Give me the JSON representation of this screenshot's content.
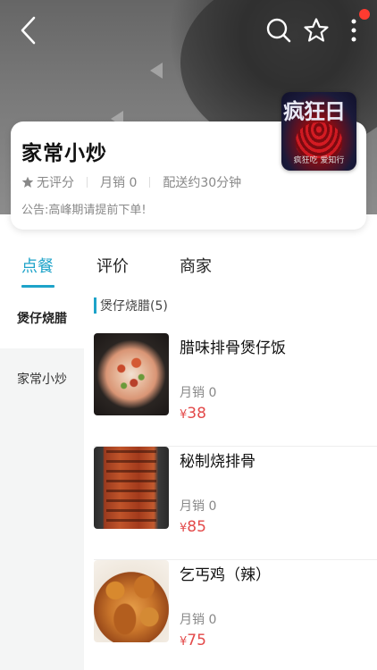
{
  "header": {
    "icons": [
      "back-arrow-icon",
      "search-icon",
      "star-outline-icon",
      "more-vertical-icon"
    ],
    "status_dot_color": "#ff3b30"
  },
  "logo": {
    "text": "疯狂日",
    "subtext": "疯狂吃 爱知行"
  },
  "shop": {
    "name": "家常小炒",
    "rating": "无评分",
    "monthly_sales": "月销 0",
    "delivery": "配送约30分钟",
    "notice": "公告:高峰期请提前下单!"
  },
  "tabs": [
    {
      "label": "点餐",
      "active": true
    },
    {
      "label": "评价",
      "active": false
    },
    {
      "label": "商家",
      "active": false
    }
  ],
  "accent_color": "#1ea3c9",
  "sidebar": {
    "items": [
      {
        "label": "煲仔烧腊",
        "active": true
      },
      {
        "label": "家常小炒",
        "active": false
      }
    ]
  },
  "section": {
    "title": "煲仔烧腊(5)"
  },
  "items": [
    {
      "title": "腊味排骨煲仔饭",
      "sales": "月销 0",
      "currency": "¥",
      "price": "38"
    },
    {
      "title": "秘制烧排骨",
      "sales": "月销 0",
      "currency": "¥",
      "price": "85"
    },
    {
      "title": "乞丐鸡（辣）",
      "sales": "月销 0",
      "currency": "¥",
      "price": "75"
    }
  ],
  "price_color": "#e34a4a"
}
